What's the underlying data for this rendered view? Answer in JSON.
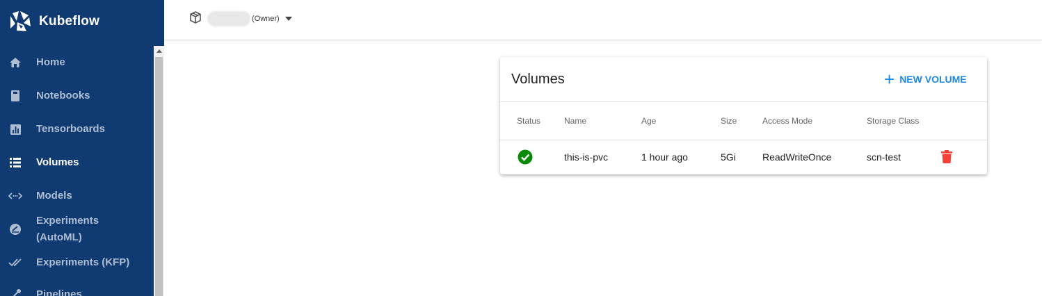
{
  "brand": {
    "name": "Kubeflow",
    "icon": "kubeflow-logo"
  },
  "sidebar": {
    "items": [
      {
        "label": "Home",
        "icon": "home-icon",
        "active": false
      },
      {
        "label": "Notebooks",
        "icon": "notebook-icon",
        "active": false
      },
      {
        "label": "Tensorboards",
        "icon": "bar-chart-icon",
        "active": false
      },
      {
        "label": "Volumes",
        "icon": "storage-list-icon",
        "active": true
      },
      {
        "label": "Models",
        "icon": "code-arrows-icon",
        "active": false
      },
      {
        "label_line1": "Experiments",
        "label_line2": "(AutoML)",
        "icon": "speed-icon",
        "active": false
      },
      {
        "label": "Experiments (KFP)",
        "icon": "double-check-icon",
        "active": false
      },
      {
        "label": "Pipelines",
        "icon": "pipeline-icon",
        "active": false
      }
    ]
  },
  "namespace": {
    "role": "(Owner)",
    "icon": "package-icon"
  },
  "volumes": {
    "title": "Volumes",
    "new_button": "NEW VOLUME",
    "columns": [
      "Status",
      "Name",
      "Age",
      "Size",
      "Access Mode",
      "Storage Class"
    ],
    "rows": [
      {
        "status": "ready",
        "name": "this-is-pvc",
        "age": "1 hour ago",
        "size": "5Gi",
        "access_mode": "ReadWriteOnce",
        "storage_class": "scn-test"
      }
    ]
  },
  "colors": {
    "sidebar": "#0f3b72",
    "accent": "#1e88e5",
    "success": "#0a8a0a",
    "danger": "#f44336"
  }
}
